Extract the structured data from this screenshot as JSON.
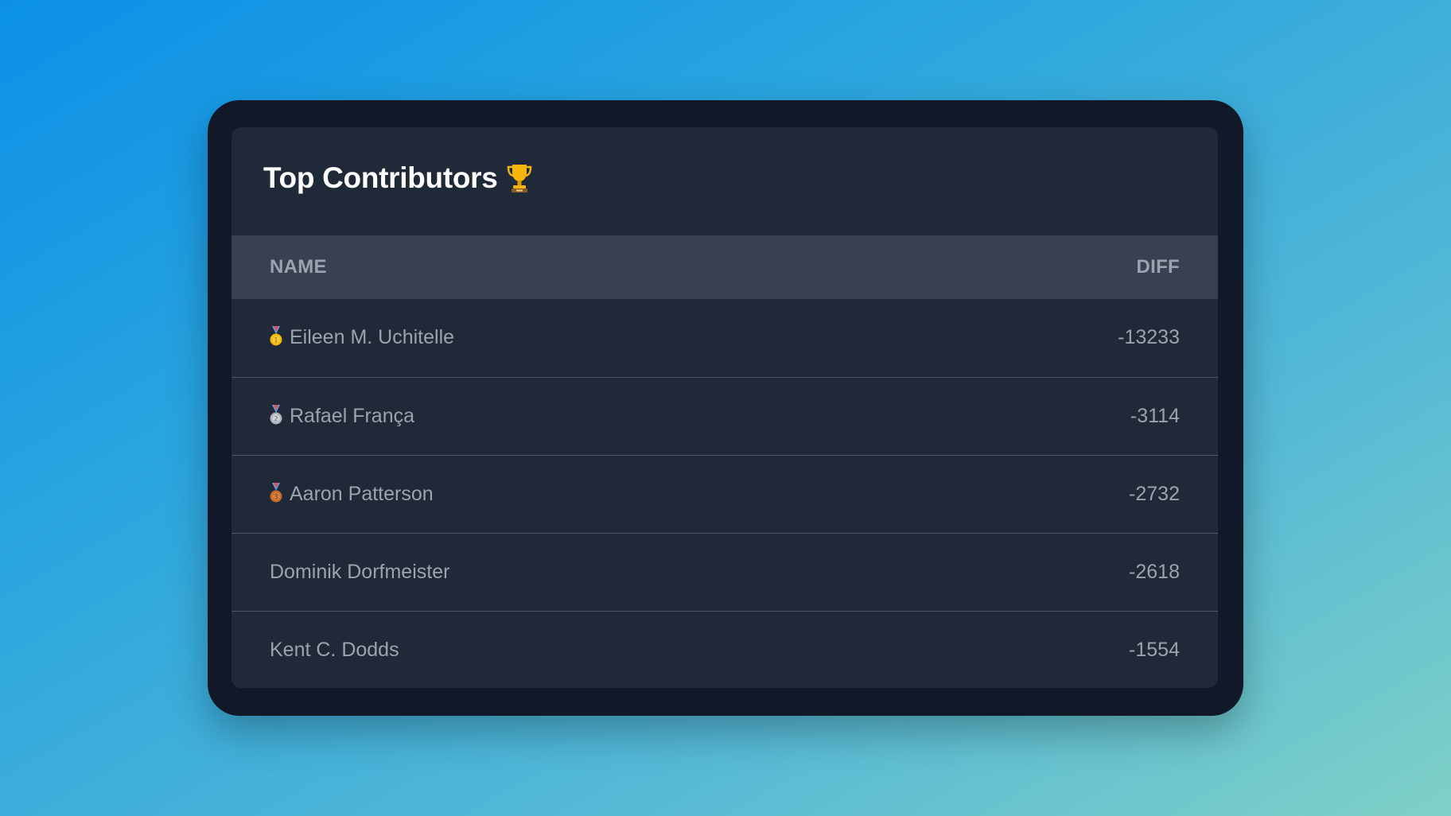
{
  "card": {
    "title": "Top Contributors",
    "title_icon": "trophy-icon"
  },
  "table": {
    "columns": [
      "NAME",
      "DIFF"
    ],
    "rows": [
      {
        "medal": "gold-medal-icon",
        "name": "Eileen M. Uchitelle",
        "diff": "-13233"
      },
      {
        "medal": "silver-medal-icon",
        "name": "Rafael França",
        "diff": "-3114"
      },
      {
        "medal": "bronze-medal-icon",
        "name": "Aaron Patterson",
        "diff": "-2732"
      },
      {
        "medal": null,
        "name": "Dominik Dorfmeister",
        "diff": "-2618"
      },
      {
        "medal": null,
        "name": "Kent C. Dodds",
        "diff": "-1554"
      }
    ]
  },
  "colors": {
    "background_gradient_start": "#0b90e8",
    "background_gradient_end": "#7fd0c6",
    "frame": "#111827",
    "card": "#1f2937",
    "header_row": "#374151",
    "text_muted": "#9ca3af",
    "title": "#ffffff",
    "gold": "#f5b50a",
    "silver": "#c0c4cc",
    "bronze": "#c2692b"
  }
}
